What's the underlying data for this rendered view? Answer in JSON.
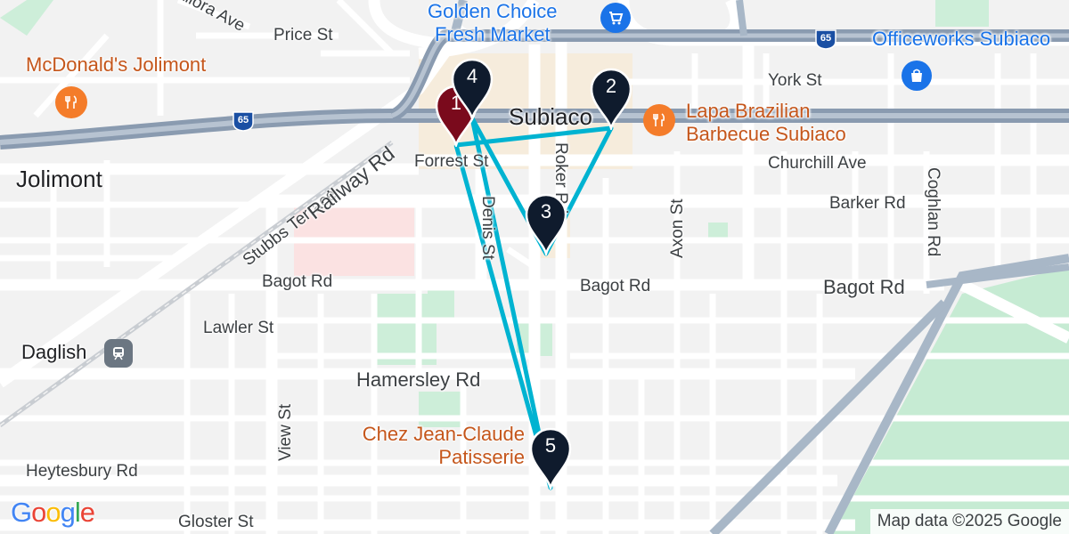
{
  "attribution": "Map data ©2025 Google",
  "google_logo": [
    "G",
    "o",
    "o",
    "g",
    "l",
    "e"
  ],
  "google_colors": [
    "#4285F4",
    "#EA4335",
    "#FBBC05",
    "#4285F4",
    "#34A853",
    "#EA4335"
  ],
  "highway_shield": "65",
  "place_labels": {
    "jolimont": "Jolimont",
    "subiaco": "Subiaco",
    "daglish": "Daglish"
  },
  "streets": {
    "allora_ave": "Allora Ave",
    "price_st": "Price St",
    "york_st": "York St",
    "forrest_st": "Forrest St",
    "roker_rd": "Roker Rd",
    "churchill_ave": "Churchill Ave",
    "barker_rd": "Barker Rd",
    "axon_st": "Axon St",
    "coghlan_rd": "Coghlan Rd",
    "stubbs_terrace": "Stubbs Terrace",
    "railway_rd": "Railway Rd",
    "denis_st": "Denis St",
    "bagot_rd_1": "Bagot Rd",
    "bagot_rd_2": "Bagot Rd",
    "bagot_rd_3": "Bagot Rd",
    "lawler_st": "Lawler St",
    "hamersley_rd": "Hamersley Rd",
    "view_st": "View St",
    "heytesbury_rd": "Heytesbury Rd",
    "gloster_st": "Gloster St"
  },
  "pois": {
    "golden_choice": {
      "line1": "Golden Choice",
      "line2": "Fresh Market",
      "icon": "shopping-cart-icon"
    },
    "officeworks": {
      "name": "Officeworks Subiaco",
      "icon": "shopping-bag-icon"
    },
    "mcdonalds": {
      "name": "McDonald's Jolimont",
      "icon": "restaurant-icon"
    },
    "lapa": {
      "line1": "Lapa Brazilian",
      "line2": "Barbecue Subiaco",
      "icon": "restaurant-icon"
    },
    "chez": {
      "line1": "Chez Jean-Claude",
      "line2": "Patisserie"
    },
    "daglish_station_icon": "train-station-icon"
  },
  "route": {
    "color": "#00b3d1",
    "order": [
      1,
      2,
      3,
      4,
      5
    ]
  },
  "markers": [
    {
      "label": "1",
      "color": "#7a0a1c"
    },
    {
      "label": "2",
      "color": "#0f1b2d"
    },
    {
      "label": "3",
      "color": "#0f1b2d"
    },
    {
      "label": "4",
      "color": "#0f1b2d"
    },
    {
      "label": "5",
      "color": "#0f1b2d"
    }
  ],
  "colors": {
    "poi_orange": "#c5561b",
    "poi_blue": "#1a73e8",
    "highway": "#8a9bb0",
    "park": "#c9ead4"
  }
}
